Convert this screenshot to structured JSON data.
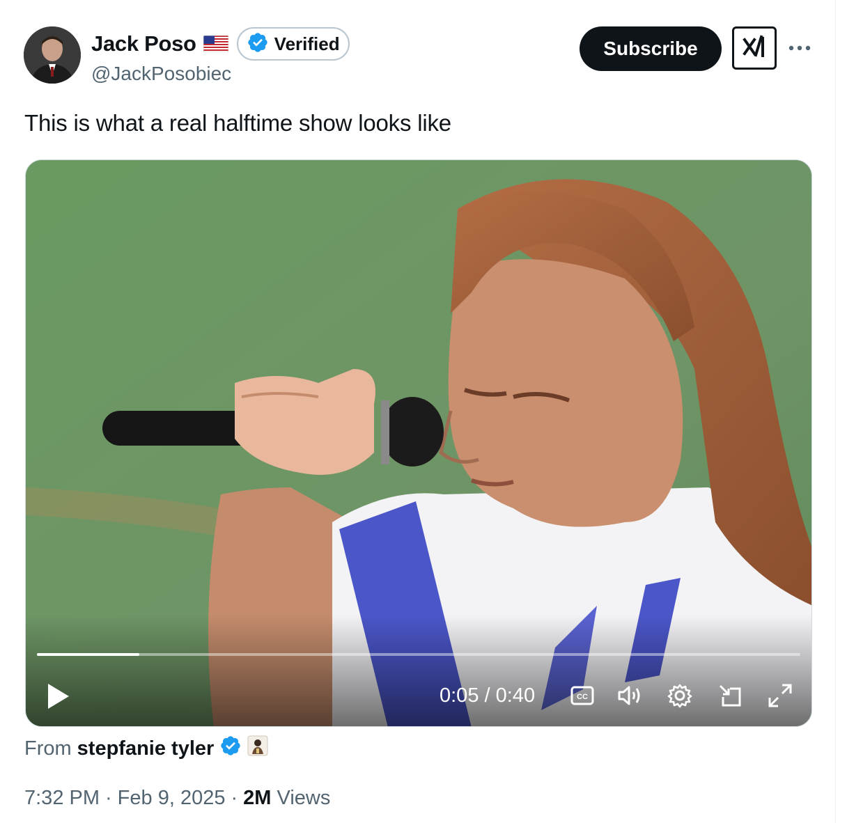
{
  "author": {
    "display_name": "Jack Poso",
    "handle": "@JackPosobiec",
    "flag_icon": "us-flag-icon",
    "verified_label": "Verified",
    "verified_color": "#1d9bf0"
  },
  "actions": {
    "subscribe_label": "Subscribe",
    "grok_icon": "xai-grok-icon",
    "more_icon": "more-icon"
  },
  "tweet": {
    "text": "This is what a real halftime show looks like"
  },
  "video": {
    "current_time": "0:05",
    "separator": " / ",
    "duration": "0:40",
    "progress": 0.134
  },
  "attribution": {
    "from_label": "From",
    "source_name": "stepfanie tyler",
    "source_badge_icon": "emoji-badge-icon"
  },
  "meta": {
    "time": "7:32 PM",
    "dot1": "·",
    "date": "Feb 9, 2025",
    "dot2": "·",
    "views_count": "2M",
    "views_label": "Views"
  }
}
